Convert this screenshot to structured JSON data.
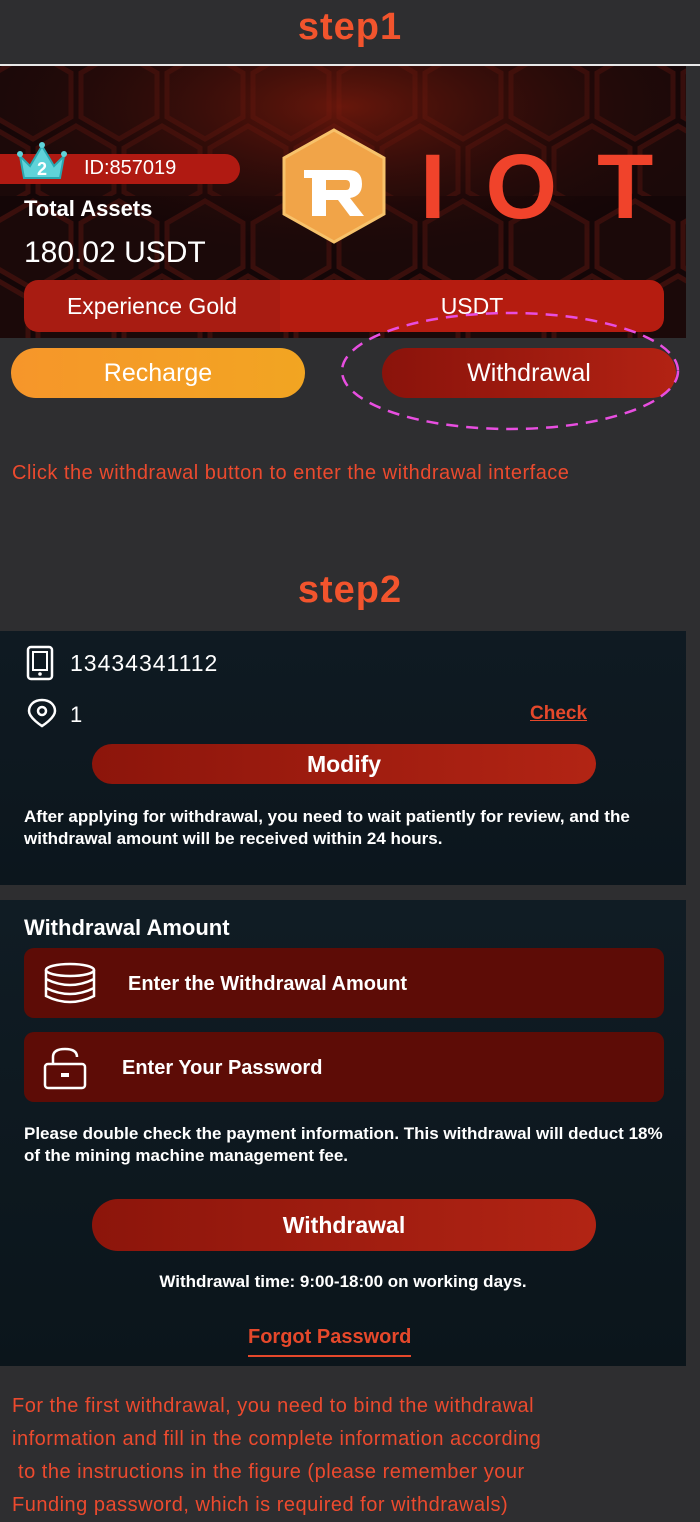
{
  "step1": {
    "title": "step1",
    "id_label": "ID:857019",
    "vip_level": "2",
    "total_assets_label": "Total Assets",
    "total_assets_value": "180.02 USDT",
    "logo_text": "IOT",
    "tabs": [
      "Experience Gold",
      "USDT"
    ],
    "recharge_label": "Recharge",
    "withdrawal_label": "Withdrawal",
    "caption": "Click the withdrawal button to enter the withdrawal interface"
  },
  "step2": {
    "title": "step2",
    "phone": "13434341112",
    "location": "1",
    "check_label": "Check",
    "modify_label": "Modify",
    "review_note": "After applying for withdrawal, you need to wait patiently for review, and the withdrawal amount will be received within 24 hours.",
    "amount_title": "Withdrawal Amount",
    "amount_placeholder": "Enter the Withdrawal Amount",
    "password_placeholder": "Enter Your Password",
    "double_check_note": "Please double check the payment information. This withdrawal will deduct 18% of the mining machine management fee.",
    "withdrawal_label": "Withdrawal",
    "withdrawal_time": "Withdrawal time: 9:00-18:00 on working days.",
    "forgot_label": "Forgot Password"
  },
  "bottom_note_lines": [
    "For the first withdrawal, you need to bind the withdrawal",
    "information and fill in the complete information according",
    " to the instructions in the figure (please remember your",
    "Funding password, which is required for withdrawals)"
  ],
  "colors": {
    "accent": "#f2542d",
    "background": "#2e2e30",
    "button_red": "#b22414",
    "button_orange": "#f6962a",
    "highlight_ellipse": "#e84ee0"
  }
}
